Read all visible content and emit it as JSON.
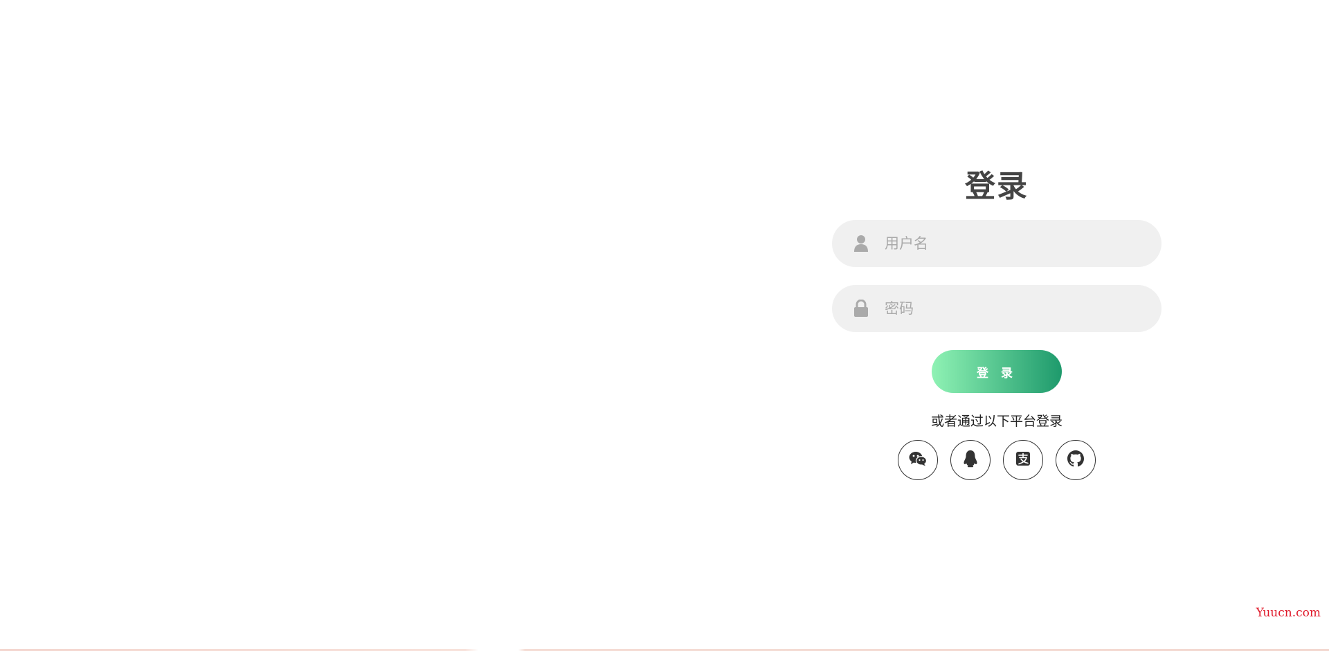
{
  "login": {
    "title": "登录",
    "username_placeholder": "用户名",
    "password_placeholder": "密码",
    "submit_label": "登 录",
    "alt_text": "或者通过以下平台登录"
  },
  "social": [
    {
      "name": "wechat",
      "icon": "wechat-icon"
    },
    {
      "name": "qq",
      "icon": "qq-penguin-icon"
    },
    {
      "name": "alipay",
      "icon": "alipay-icon"
    },
    {
      "name": "github",
      "icon": "github-icon"
    }
  ],
  "watermark": "Yuucn.com",
  "colors": {
    "button_gradient_start": "#8ff2b4",
    "button_gradient_end": "#1e9a6c",
    "field_bg": "#f0f0f0",
    "title": "#444444",
    "watermark": "#e0192a"
  }
}
